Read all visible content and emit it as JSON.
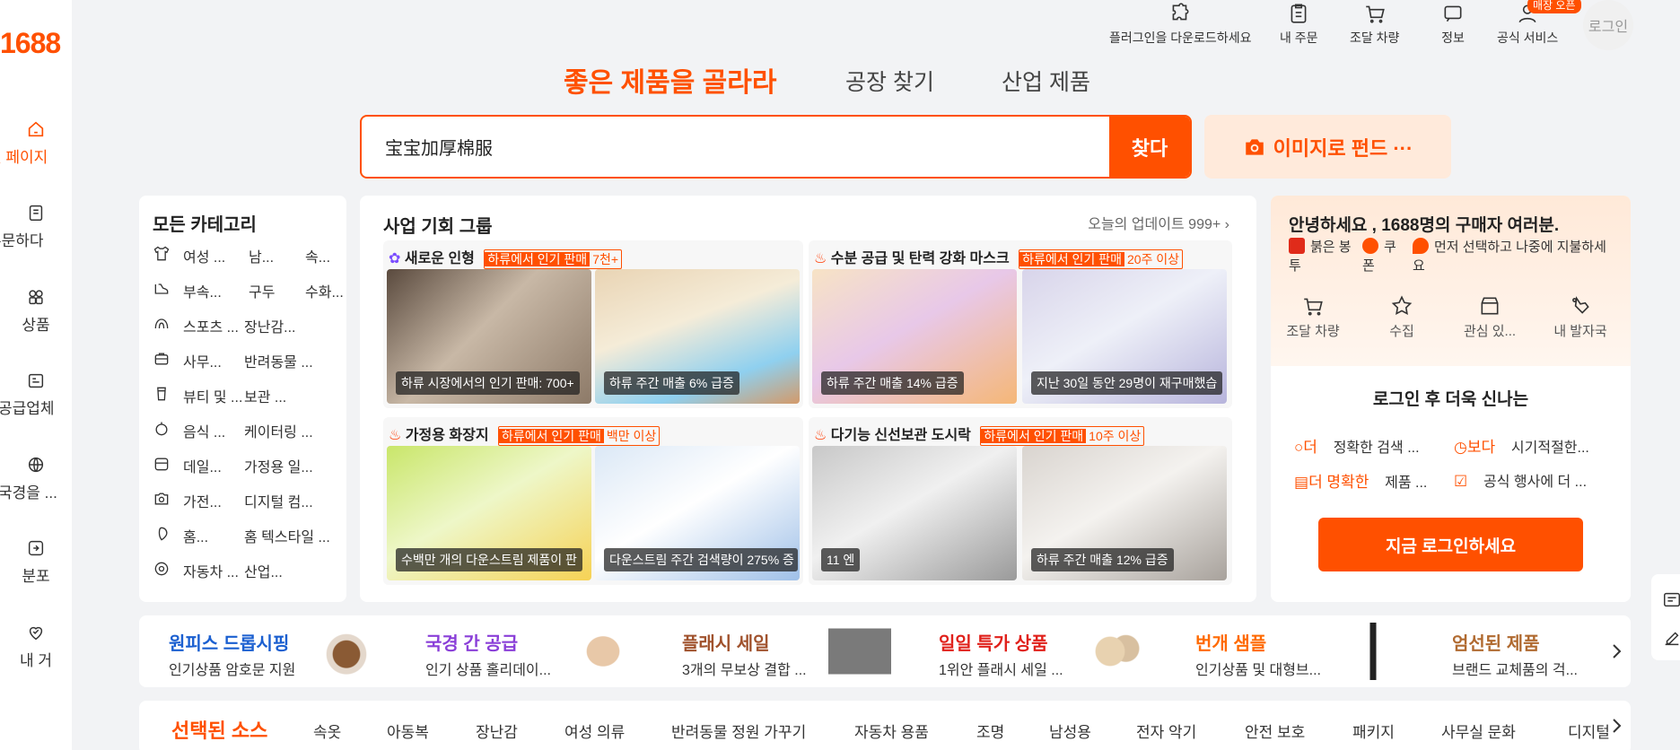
{
  "colors": {
    "accent": "#ff5000",
    "accent_light": "#ffeadb"
  },
  "sidebar": {
    "logo": "1688",
    "items": [
      {
        "label": "첫 페이지",
        "icon": "home-icon",
        "active": true
      },
      {
        "label": "주문하다",
        "icon": "order-icon"
      },
      {
        "label": "상품",
        "icon": "grid-icon"
      },
      {
        "label": "공급업체",
        "icon": "supplier-icon"
      },
      {
        "label": "국경을 ...",
        "icon": "globe-icon"
      },
      {
        "label": "분포",
        "icon": "distribute-icon"
      },
      {
        "label": "내 거",
        "icon": "heart-icon"
      }
    ]
  },
  "topbar": {
    "items": [
      {
        "label": "플러그인을 다운로드하세요",
        "icon": "puzzle-icon"
      },
      {
        "label": "내 주문",
        "icon": "clipboard-icon"
      },
      {
        "label": "조달 차량",
        "icon": "cart-icon"
      },
      {
        "label": "정보",
        "icon": "message-icon"
      },
      {
        "label": "공식 서비스",
        "icon": "user-icon"
      }
    ],
    "store_badge": "매장 오픈",
    "login": "로그인"
  },
  "search": {
    "tabs": [
      "좋은 제품을 골라라",
      "공장 찾기",
      "산업 제품"
    ],
    "query": "宝宝加厚棉服",
    "button": "찾다",
    "image_search": "이미지로 펀드 ···"
  },
  "categories": {
    "title": "모든 카테고리",
    "rows": [
      {
        "icon": "shirt-icon",
        "items": [
          "여성 ...",
          "남...",
          "속..."
        ]
      },
      {
        "icon": "shoe-icon",
        "items": [
          "부속...",
          "구두",
          "수화..."
        ]
      },
      {
        "icon": "sports-icon",
        "items": [
          "스포츠 ...",
          "장난감..."
        ]
      },
      {
        "icon": "office-icon",
        "items": [
          "사무...",
          "반려동물 ..."
        ]
      },
      {
        "icon": "beauty-icon",
        "items": [
          "뷰티 및 ...",
          "보관 ..."
        ]
      },
      {
        "icon": "food-icon",
        "items": [
          "음식 ...",
          "케이터링 ..."
        ]
      },
      {
        "icon": "daily-icon",
        "items": [
          "데일...",
          "가정용 일..."
        ]
      },
      {
        "icon": "camera-icon",
        "items": [
          "가전...",
          "디지털 컴..."
        ]
      },
      {
        "icon": "home-textile-icon",
        "items": [
          "홈...",
          "홈 텍스타일 ..."
        ]
      },
      {
        "icon": "car-icon",
        "items": [
          "자동차 ...",
          "산업..."
        ]
      }
    ]
  },
  "opportunity": {
    "title": "사업 기회 그룹",
    "update": "오늘의 업데이트 999+",
    "cards": [
      {
        "title": "새로운 인형",
        "tag": "하류에서 인기 판매",
        "tag_value": "7천+",
        "captions": [
          "하류 시장에서의 인기 판매: 700+",
          "하류 주간 매출 6% 급증"
        ]
      },
      {
        "title": "수분 공급 및 탄력 강화 마스크",
        "tag": "하류에서 인기 판매",
        "tag_value": "20주 이상",
        "captions": [
          "하류 주간 매출 14% 급증",
          "지난 30일 동안 29명이 재구매했습"
        ]
      },
      {
        "title": "가정용 화장지",
        "tag": "하류에서 인기 판매",
        "tag_value": "백만 이상",
        "captions": [
          "수백만 개의 다운스트림 제품이 판",
          "다운스트림 주간 검색량이 275% 증"
        ]
      },
      {
        "title": "다기능 신선보관 도시락",
        "tag": "하류에서 인기 판매",
        "tag_value": "10주 이상",
        "captions": [
          "11 엔",
          "하류 주간 매출 12% 급증"
        ]
      }
    ]
  },
  "welcome": {
    "title": "안녕하세요 , 1688명의 구매자 여러분.",
    "perks": [
      "붉은 봉투",
      "쿠폰",
      "먼저 선택하고 나중에 지불하세요"
    ],
    "quick": [
      "조달 차량",
      "수집",
      "관심 있...",
      "내 발자국"
    ],
    "login_more": "로그인 후 더욱 신나는",
    "features": [
      {
        "o": "더",
        "t": "정확한 검색 ..."
      },
      {
        "o": "보다",
        "t": "시기적절한..."
      },
      {
        "o": "더 명확한",
        "t": "제품 ..."
      },
      {
        "o": "",
        "t": "공식 행사에 더 ..."
      }
    ],
    "login_button": "지금 로그인하세요"
  },
  "promos": [
    {
      "title": "원피스 드롭시핑",
      "sub": "인기상품 암호문 지원",
      "color": "#1a5fd0"
    },
    {
      "title": "국경 간 공급",
      "sub": "인기 상품 홀리데이...",
      "color": "#8a3fd8"
    },
    {
      "title": "플래시 세일",
      "sub": "3개의 무보상 결합 ...",
      "color": "#a0522d"
    },
    {
      "title": "일일 특가 상품",
      "sub": "1위안 플래시 세일 ...",
      "color": "#e0201a"
    },
    {
      "title": "번개 샘플",
      "sub": "인기상품 및 대형브...",
      "color": "#ff6a00"
    },
    {
      "title": "엄선된 제품",
      "sub": "브랜드 교체품의 걱...",
      "color": "#b06a30"
    }
  ],
  "sources": {
    "title": "선택된 소스",
    "items": [
      "속옷",
      "아동복",
      "장난감",
      "여성 의류",
      "반려동물 정원 가꾸기",
      "자동차 용품",
      "조명",
      "남성용",
      "전자 악기",
      "안전 보호",
      "패키지",
      "사무실 문화",
      "디지털"
    ]
  }
}
